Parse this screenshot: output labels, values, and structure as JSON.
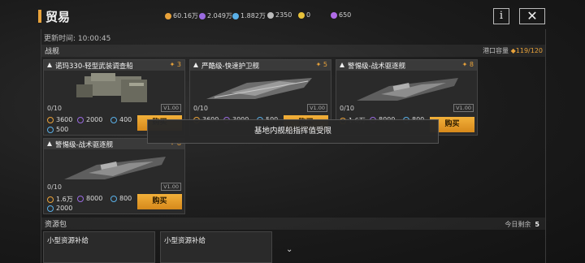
{
  "header": {
    "title": "贸易",
    "resources": [
      {
        "icon": "gold-coin-icon",
        "value": "60.16万",
        "color": "#e8a23a"
      },
      {
        "icon": "purple-crystal-icon",
        "value": "2.049万",
        "color": "#9a6be0"
      },
      {
        "icon": "blue-gas-icon",
        "value": "1.882万",
        "color": "#5ab0e8"
      },
      {
        "icon": "gray-alloy-icon",
        "value": "2350",
        "color": "#bbbbbb"
      },
      {
        "icon": "yellow-medal-icon",
        "value": "0",
        "color": "#e8c23a"
      },
      {
        "icon": "violet-gem-icon",
        "value": "650",
        "color": "#b06be8"
      }
    ],
    "info_label": "i",
    "close_label": "✕"
  },
  "updated": "更新时间: 10:00:45",
  "ships_section": {
    "title": "战舰",
    "capacity_label": "港口容量",
    "capacity_value": "119/120",
    "cards": [
      {
        "name": "诺玛330-轻型武装调查船",
        "level": "3",
        "stock": "0/10",
        "version": "V1.00",
        "costs": [
          {
            "icon": "gold-coin-icon",
            "value": "3600"
          },
          {
            "icon": "purple-crystal-icon",
            "value": "2000"
          },
          {
            "icon": "blue-gas-icon",
            "value": "400"
          },
          {
            "icon": "blue-gas-icon",
            "value": "500"
          }
        ],
        "buy": "购买"
      },
      {
        "name": "严酷级-快速护卫舰",
        "level": "5",
        "stock": "0/10",
        "version": "V1.00",
        "costs": [
          {
            "icon": "gold-coin-icon",
            "value": "3600"
          },
          {
            "icon": "purple-crystal-icon",
            "value": "3000"
          },
          {
            "icon": "blue-gas-icon",
            "value": "500"
          }
        ],
        "buy": "购买"
      },
      {
        "name": "警惕级-战术驱逐舰",
        "level": "8",
        "stock": "0/10",
        "version": "V1.00",
        "costs": [
          {
            "icon": "gold-coin-icon",
            "value": "1.6万"
          },
          {
            "icon": "purple-crystal-icon",
            "value": "8000"
          },
          {
            "icon": "blue-gas-icon",
            "value": "800"
          }
        ],
        "buy": "购买"
      },
      {
        "name": "警惕级-战术驱逐舰",
        "level": "8",
        "stock": "0/10",
        "version": "V1.00",
        "costs": [
          {
            "icon": "gold-coin-icon",
            "value": "1.6万"
          },
          {
            "icon": "purple-crystal-icon",
            "value": "8000"
          },
          {
            "icon": "blue-gas-icon",
            "value": "800"
          },
          {
            "icon": "blue-gas-icon",
            "value": "2000"
          }
        ],
        "buy": "购买"
      }
    ]
  },
  "toast": "基地内舰船指挥值受限",
  "packs_section": {
    "title": "资源包",
    "today_label": "今日剩余",
    "today_value": "5",
    "packs": [
      {
        "name": "小型资源补给"
      },
      {
        "name": "小型资源补给"
      }
    ]
  }
}
